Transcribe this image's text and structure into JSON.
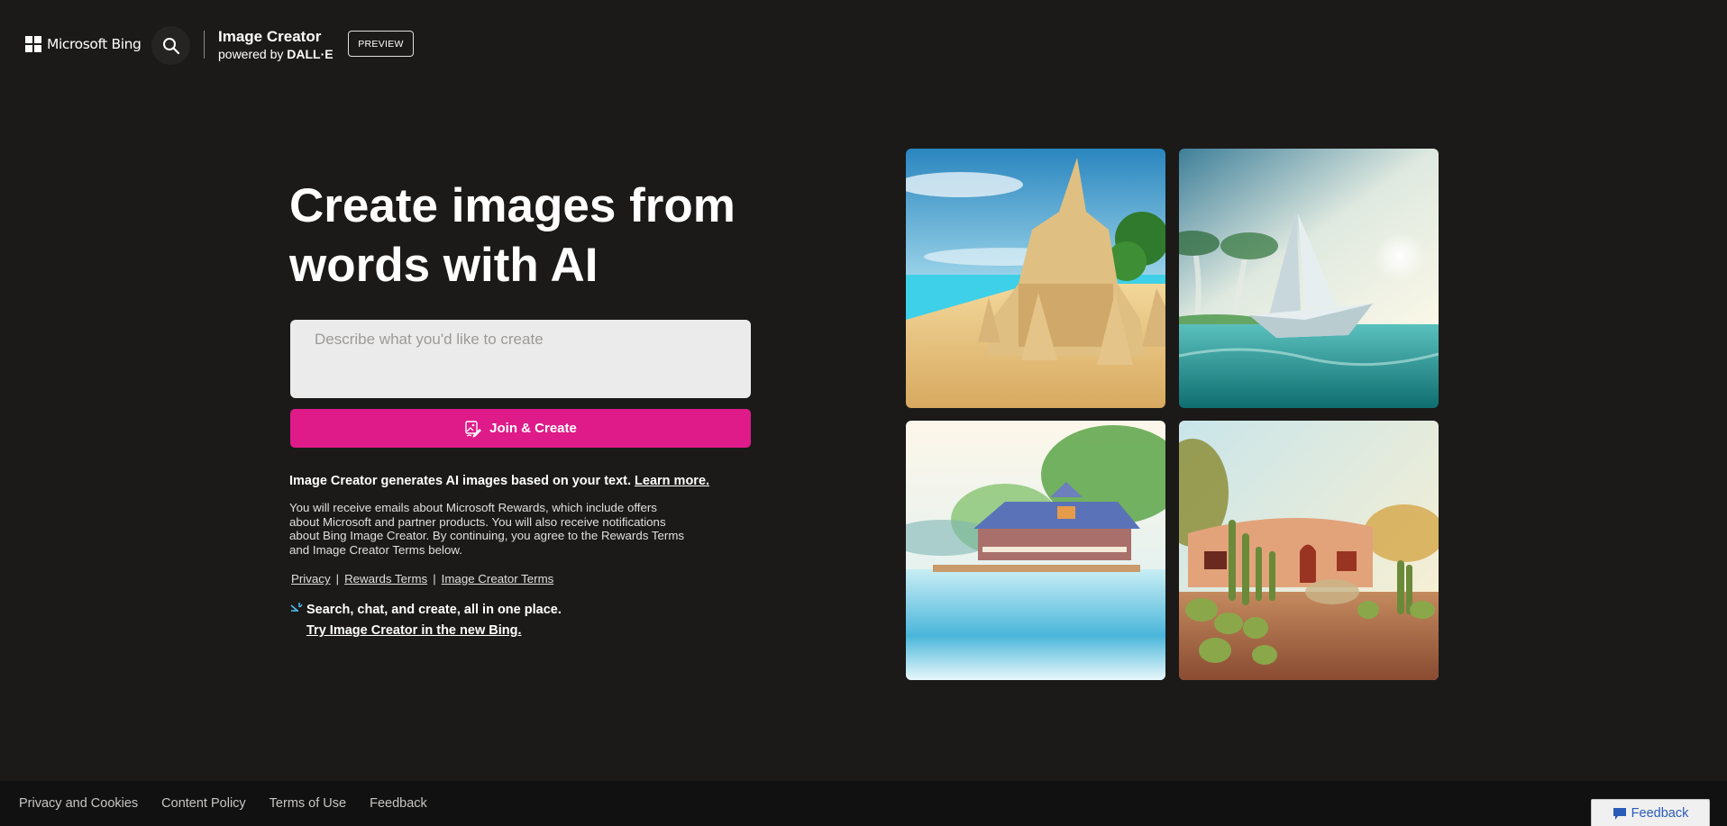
{
  "header": {
    "logo_text": "Microsoft Bing",
    "search_icon": "search-icon",
    "brand_title": "Image Creator",
    "brand_powered_by": "powered by",
    "brand_engine": "DALL·E",
    "badge": "PREVIEW"
  },
  "hero": {
    "title_line1": "Create images from",
    "title_line2": "words with AI",
    "prompt_placeholder": "Describe what you'd like to create",
    "prompt_value": "",
    "join_button_icon": "image-edit-icon",
    "join_button_label": "Join & Create",
    "info_bold": "Image Creator generates AI images based on your text.",
    "learn_more": "Learn more.",
    "info_small": "You will receive emails about Microsoft Rewards, which include offers about Microsoft and partner products. You will also receive notifications about Bing Image Creator. By continuing, you agree to the Rewards Terms and Image Creator Terms below.",
    "legal_links": [
      "Privacy",
      "Rewards Terms",
      "Image Creator Terms"
    ],
    "legal_separator": "|",
    "promo_icon": "sparkle-icon",
    "promo_text": "Search, chat, and create, all in one place.",
    "promo_link": "Try Image Creator in the new Bing."
  },
  "gallery": {
    "images": [
      {
        "subject": "Sandcastle on a tropical beach"
      },
      {
        "subject": "Paper sailboat on the ocean"
      },
      {
        "subject": "Watercolor lake house"
      },
      {
        "subject": "Adobe house with cacti at sunset"
      }
    ]
  },
  "footer": {
    "links": [
      "Privacy and Cookies",
      "Content Policy",
      "Terms of Use",
      "Feedback"
    ],
    "feedback_button": "Feedback",
    "feedback_icon": "chat-bubble-icon"
  },
  "colors": {
    "background": "#1b1a19",
    "footer_background": "#111111",
    "accent": "#de1b89",
    "feedback_blue": "#2a5bb8"
  }
}
